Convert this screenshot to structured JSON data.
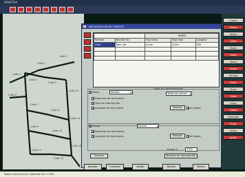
{
  "window": {
    "title": "MINISTRA"
  },
  "map": {
    "labels": [
      "Calle 1",
      "Calle 2",
      "Calle 3",
      "Calle 4",
      "Calle 5",
      "Calle 6",
      "Calle 7",
      "Calle 8",
      "Calle 9",
      "Calle 10",
      "Calle 11",
      "Calle 12",
      "Calle 13",
      "Calle 14",
      "Calle 15"
    ]
  },
  "dialog": {
    "title": "INFORMACION DE TRAMOS",
    "grid": {
      "group_header": "TRAMO",
      "columns": [
        "Nombre",
        "Nombre Sin",
        "Tipo Inicio",
        "Tipo Final",
        "Longitud"
      ],
      "rows": [
        [
          "Calle",
          "Nom. Ab",
          "Cruce",
          "Cruce",
          "200"
        ],
        [
          "",
          "",
          "",
          "",
          ""
        ],
        [
          "",
          "",
          "",
          "",
          ""
        ],
        [
          "",
          "",
          "",
          "",
          ""
        ]
      ]
    },
    "options": {
      "datos_label": "Datos",
      "datos_dd": "Normal",
      "check1": "Direccion de los tramos",
      "check2": "Tipo de intersección",
      "check3": "Longitud de los tramos",
      "filter_title": "Tipos de representación",
      "filter_dd": "Todos los tramos",
      "btn_mostrar1": "Mostrar",
      "chk_todos1": "en todos",
      "grupo_label": "Grupo",
      "grupo_dd": "Normal",
      "check4": "Dirección de los tramos",
      "check5": "Longitud de los tramos",
      "btn_mostrar2": "Mostrar",
      "chk_todos2": "en todos",
      "escala_label": "Escala 1:",
      "escala_value": "1700",
      "btn_nuevos": "Nuevos",
      "btn_numero": "Número de intersección"
    }
  },
  "bottom_buttons": [
    "Aceptar",
    "Cancelar",
    "Ayuda",
    "Dibujar",
    "Borrar"
  ],
  "right_panel": [
    "Cuadro",
    "Tramos",
    "Nodos",
    "Calles",
    "Redes",
    "Datos",
    "Zonas",
    "Lineas",
    "Paradas",
    "Viajes",
    "Buses",
    "Rutas",
    "Horas",
    "Costes",
    "Demanda",
    "Flujos",
    "Salida",
    "Ayuda"
  ],
  "status": {
    "text": "Mapa  Calles   Archivo: mapa.dat   Esc 1:1700"
  },
  "colors": {
    "accent": "#c63a3a",
    "title_blue": "#33449a"
  }
}
